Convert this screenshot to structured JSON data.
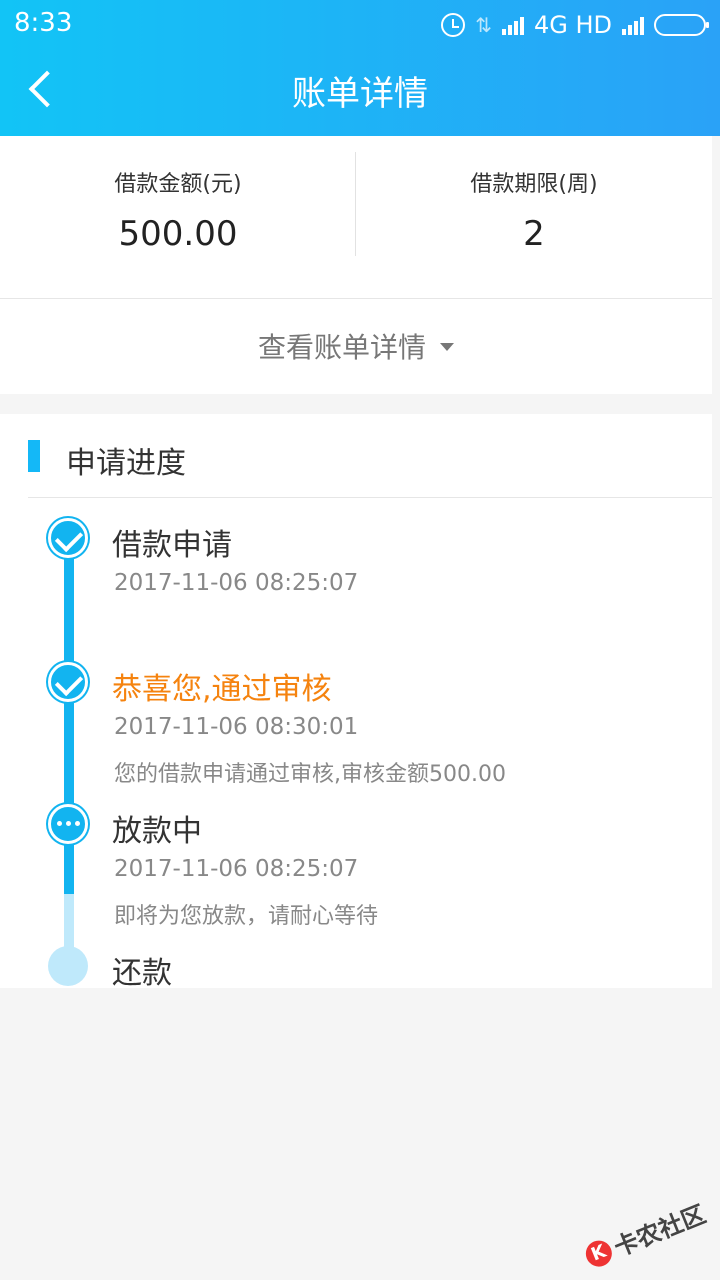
{
  "status_bar": {
    "time": "8:33",
    "network": "4G HD"
  },
  "header": {
    "title": "账单详情"
  },
  "summary": {
    "amount_label": "借款金额(元)",
    "amount_value": "500.00",
    "term_label": "借款期限(周)",
    "term_value": "2",
    "detail_link": "查看账单详情"
  },
  "progress": {
    "section_title": "申请进度",
    "steps": [
      {
        "title": "借款申请",
        "time": "2017-11-06 08:25:07",
        "note": "",
        "state": "done"
      },
      {
        "title": "恭喜您,通过审核",
        "time": "2017-11-06 08:30:01",
        "note": "您的借款申请通过审核,审核金额500.00",
        "state": "done"
      },
      {
        "title": "放款中",
        "time": "2017-11-06 08:25:07",
        "note": "即将为您放款，请耐心等待",
        "state": "in-progress"
      },
      {
        "title": "还款",
        "time": "",
        "note": "",
        "state": "pending"
      }
    ]
  },
  "watermark": {
    "text": "卡农社区",
    "icon": "kanong-logo-icon"
  },
  "colors": {
    "header_start": "#12c4f6",
    "header_end": "#2aa2f7",
    "accent": "#12b4f0",
    "highlight": "#f5830f",
    "pending": "#bfe9fb"
  }
}
